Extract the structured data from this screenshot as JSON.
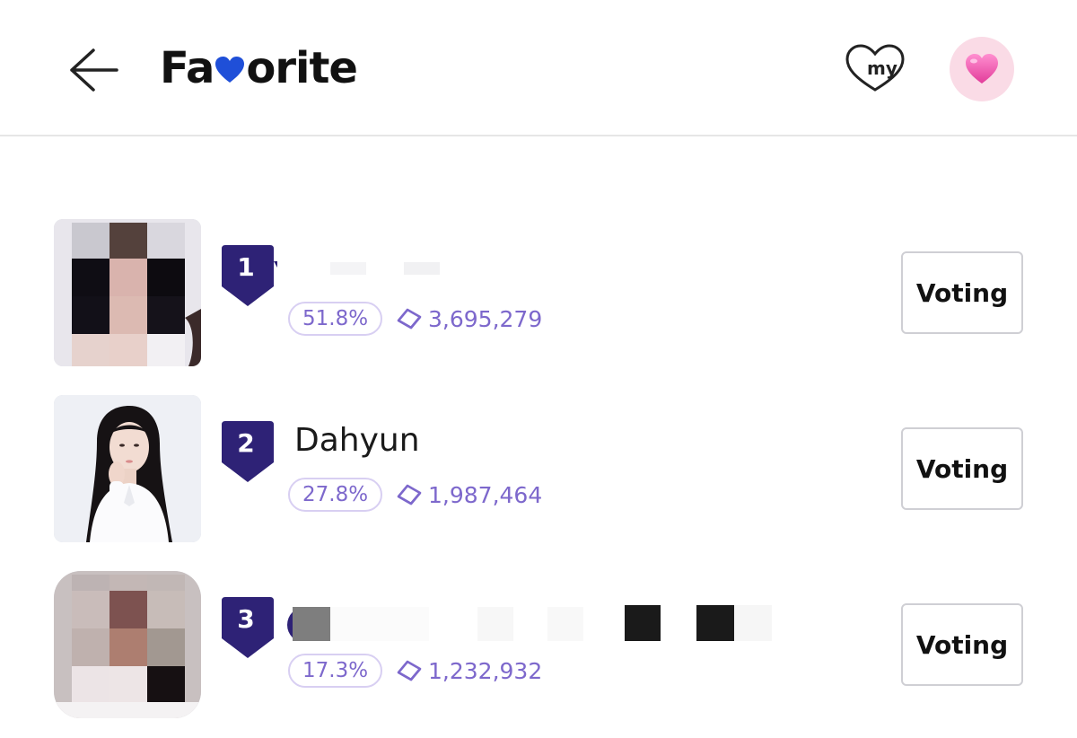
{
  "header": {
    "title_part1": "Fa",
    "title_part2": "orite",
    "my_label": "my",
    "heart_color": "#1f4fd8"
  },
  "ranking": [
    {
      "rank": "1",
      "name": "",
      "percent": "51.8%",
      "votes": "3,695,279",
      "name_censored": true
    },
    {
      "rank": "2",
      "name": "Dahyun",
      "percent": "27.8%",
      "votes": "1,987,464",
      "name_censored": false
    },
    {
      "rank": "3",
      "name": "",
      "percent": "17.3%",
      "votes": "1,232,932",
      "name_censored": true
    }
  ],
  "voting_label": "Voting",
  "colors": {
    "badge": "#2e2276",
    "accent": "#7d68cc",
    "pill_border": "#d8cff2",
    "heart_bg": "#fadbe6"
  },
  "icons": {
    "back": "arrow-left-icon",
    "my": "heart-outline-my-icon",
    "heart": "pink-heart-icon",
    "gem": "gem-icon"
  }
}
